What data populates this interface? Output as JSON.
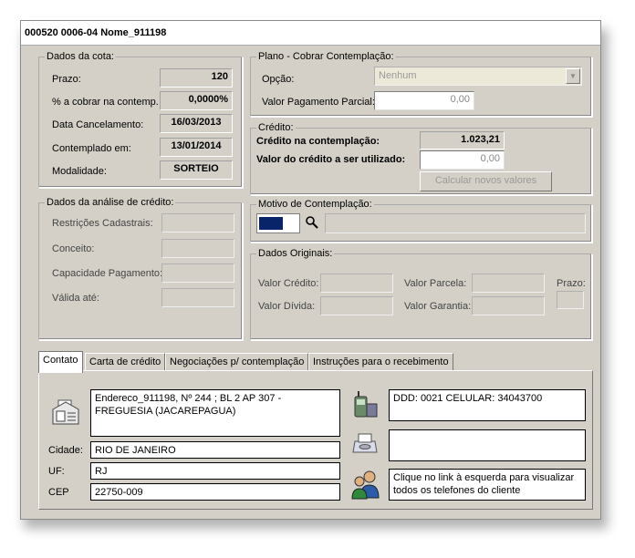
{
  "window": {
    "title": "000520 0006-04 Nome_911198"
  },
  "dados_cota": {
    "legend": "Dados da cota:",
    "rows": [
      {
        "label": "Prazo:",
        "value": "120"
      },
      {
        "label": "% a cobrar na contemp.",
        "value": "0,0000%"
      },
      {
        "label": "Data Cancelamento:",
        "value": "16/03/2013"
      },
      {
        "label": "Contemplado em:",
        "value": "13/01/2014"
      },
      {
        "label": "Modalidade:",
        "value": "SORTEIO"
      }
    ]
  },
  "analise_credito": {
    "legend": "Dados da análise de crédito:",
    "rows": [
      {
        "label": "Restrições Cadastrais:",
        "value": ""
      },
      {
        "label": "Conceito:",
        "value": ""
      },
      {
        "label": "Capacidade Pagamento:",
        "value": ""
      },
      {
        "label": "Válida até:",
        "value": ""
      }
    ]
  },
  "plano": {
    "legend": "Plano - Cobrar Contemplação:",
    "opcao_label": "Opção:",
    "opcao_value": "Nenhum",
    "valor_parcial_label": "Valor Pagamento Parcial:",
    "valor_parcial_value": "0,00"
  },
  "credito": {
    "legend": "Crédito:",
    "contemplacao_label": "Crédito na contemplação:",
    "contemplacao_value": "1.023,21",
    "utilizado_label": "Valor do crédito a ser utilizado:",
    "utilizado_value": "0,00",
    "calc_button": "Calcular novos valores"
  },
  "motivo": {
    "legend": "Motivo de Contemplação:",
    "code": "",
    "description": ""
  },
  "originais": {
    "legend": "Dados Originais:",
    "valor_credito_label": "Valor Crédito:",
    "valor_divida_label": "Valor Dívida:",
    "valor_parcela_label": "Valor Parcela:",
    "valor_garantia_label": "Valor Garantia:",
    "prazo_label": "Prazo:"
  },
  "tabs": [
    {
      "label": "Contato"
    },
    {
      "label": "Carta de crédito"
    },
    {
      "label": "Negociações p/ contemplação"
    },
    {
      "label": "Instruções para o recebimento"
    }
  ],
  "contato": {
    "endereco": "Endereco_911198, Nº 244 ; BL 2 AP 307 - FREGUESIA (JACAREPAGUA)",
    "cidade_label": "Cidade:",
    "cidade": "RIO DE JANEIRO",
    "uf_label": "UF:",
    "uf": "RJ",
    "cep_label": "CEP",
    "cep": "22750-009",
    "telefone": "DDD: 0021  CELULAR: 34043700",
    "fax": "",
    "link_info": "Clique no link à esquerda para visualizar todos os telefones do cliente"
  },
  "icons": [
    "address-card-icon",
    "cell-phone-icon",
    "fax-icon",
    "users-link-icon",
    "search-icon"
  ],
  "colors": {
    "window_bg": "#d4d0c8",
    "motivo_code_fill": "#0a246a"
  }
}
